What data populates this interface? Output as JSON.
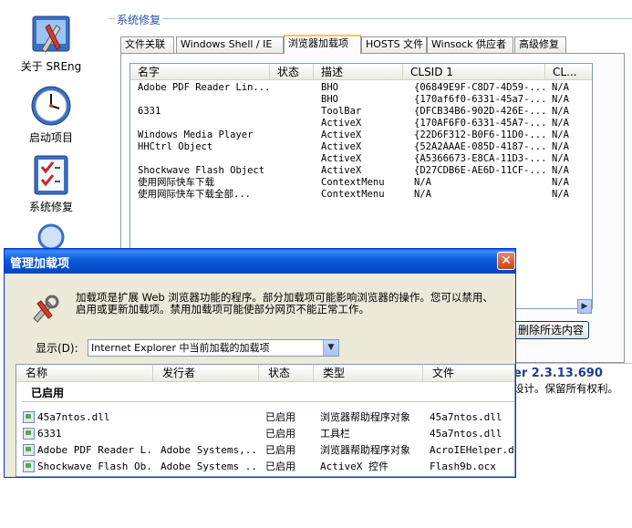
{
  "sidebar": {
    "items": [
      {
        "label": "关于 SREng",
        "icon": "tools-icon"
      },
      {
        "label": "启动项目",
        "icon": "clock-icon"
      },
      {
        "label": "系统修复",
        "icon": "checklist-icon"
      },
      {
        "label": "",
        "icon": "magnifier-icon"
      }
    ]
  },
  "main": {
    "group_title": "系统修复",
    "tabs": [
      "文件关联",
      "Windows Shell / IE",
      "浏览器加载项",
      "HOSTS 文件",
      "Winsock 供应者",
      "高级修复"
    ],
    "active_tab": 2,
    "list": {
      "columns": [
        "名字",
        "状态",
        "描述",
        "CLSID 1",
        "CL..."
      ],
      "rows": [
        [
          "Adobe PDF Reader Lin...",
          "",
          "BHO",
          "{06849E9F-C8D7-4D59-...",
          "N/A"
        ],
        [
          "",
          "",
          "BHO",
          "{170af6f0-6331-45a7-...",
          "N/A"
        ],
        [
          "6331",
          "",
          "ToolBar",
          "{DFCB34B6-902D-426E-...",
          "N/A"
        ],
        [
          "",
          "",
          "ActiveX",
          "{170AF6F0-6331-45A7-...",
          "N/A"
        ],
        [
          "Windows Media Player",
          "",
          "ActiveX",
          "{22D6F312-B0F6-11D0-...",
          "N/A"
        ],
        [
          "HHCtrl Object",
          "",
          "ActiveX",
          "{52A2AAAE-085D-4187-...",
          "N/A"
        ],
        [
          "",
          "",
          "ActiveX",
          "{A5366673-E8CA-11D3-...",
          "N/A"
        ],
        [
          "Shockwave Flash Object",
          "",
          "ActiveX",
          "{D27CDB6E-AE6D-11CF-...",
          "N/A"
        ],
        [
          "使用网际快车下载",
          "",
          "ContextMenu",
          "N/A",
          "N/A"
        ],
        [
          "使用网际快车下载全部...",
          "",
          "ContextMenu",
          "N/A",
          "N/A"
        ]
      ]
    },
    "remove_button": "删除所选内容",
    "version_text": "er 2.3.13.690",
    "copyright_text": "设计。保留所有权利。"
  },
  "dialog": {
    "title": "管理加载项",
    "close_glyph": "✕",
    "description": "加载项是扩展 Web 浏览器功能的程序。部分加载项可能影响浏览器的操作。您可以禁用、启用或更新加载项。禁用加载项可能使部分网页不能正常工作。",
    "show_label": "显示(D):",
    "show_value": "Internet Explorer 中当前加载的加载项",
    "columns": [
      "名称",
      "发行者",
      "状态",
      "类型",
      "文件"
    ],
    "group_label": "已启用",
    "rows": [
      [
        "45a7ntos.dll",
        "",
        "已启用",
        "浏览器帮助程序对象",
        "45a7ntos.dll"
      ],
      [
        "6331",
        "",
        "已启用",
        "工具栏",
        "45a7ntos.dll"
      ],
      [
        "Adobe PDF Reader L...",
        "Adobe Systems,...",
        "已启用",
        "浏览器帮助程序对象",
        "AcroIEHelper.dll"
      ],
      [
        "Shockwave Flash Ob...",
        "Adobe Systems ...",
        "已启用",
        "ActiveX 控件",
        "Flash9b.ocx"
      ]
    ]
  }
}
